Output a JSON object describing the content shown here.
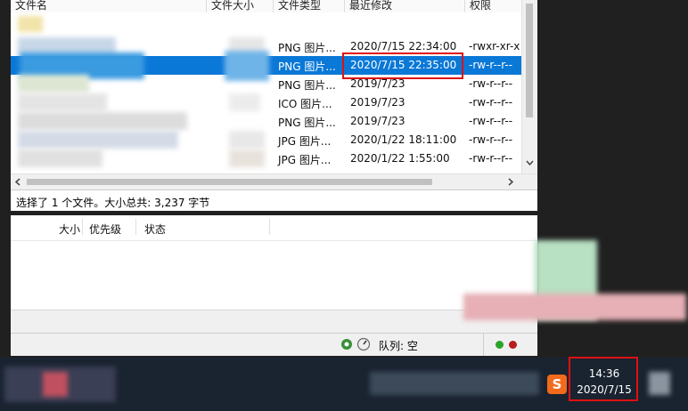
{
  "file_list": {
    "columns": [
      "文件名",
      "文件大小",
      "文件类型",
      "最近修改",
      "权限"
    ],
    "rows": [
      {
        "type": "PNG 图片...",
        "modified": "2020/7/15 22:34:00",
        "perm": "-rwxr-xr-x",
        "selected": false
      },
      {
        "type": "PNG 图片...",
        "modified": "2020/7/15 22:35:00",
        "perm": "-rw-r--r--",
        "selected": true
      },
      {
        "type": "PNG 图片...",
        "modified": "2019/7/23",
        "perm": "-rw-r--r--",
        "selected": false
      },
      {
        "type": "ICO 图片...",
        "modified": "2019/7/23",
        "perm": "-rw-r--r--",
        "selected": false
      },
      {
        "type": "PNG 图片...",
        "modified": "2019/7/23",
        "perm": "-rw-r--r--",
        "selected": false
      },
      {
        "type": "JPG 图片...",
        "modified": "2020/1/22 18:11:00",
        "perm": "-rw-r--r--",
        "selected": false
      },
      {
        "type": "JPG 图片...",
        "modified": "2020/1/22 1:55:00",
        "perm": "-rw-r--r--",
        "selected": false
      }
    ],
    "status_text": "选择了 1 个文件。大小总共: 3,237 字节"
  },
  "queue": {
    "columns": [
      "大小",
      "优先级",
      "状态"
    ],
    "status_label": "队列: 空"
  },
  "taskbar": {
    "time": "14:36",
    "date": "2020/7/15",
    "ime_glyph": "S"
  },
  "colors": {
    "selection": "#0a78d7",
    "highlight_box": "#e01010"
  }
}
